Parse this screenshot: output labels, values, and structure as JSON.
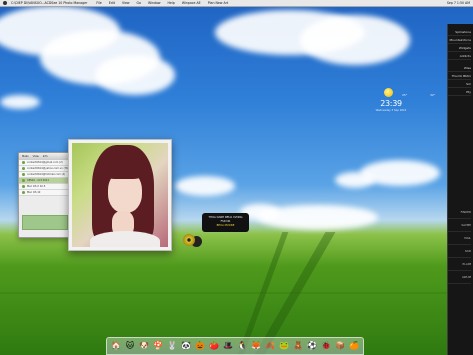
{
  "menubar": {
    "title": "C:\\DIEP DI\\VANSUO...ACDSee 10 Photo Manager",
    "items": [
      "File",
      "Edit",
      "View",
      "Go",
      "Window",
      "Help",
      "Winpace AE",
      "Plan New Art"
    ],
    "right": "Sep 7 1:50 AM"
  },
  "sidebar": {
    "top_items": [
      "Splinstone",
      "Mountainforce",
      "Widgets",
      "Addictv"
    ],
    "mid_items": [
      "Wise",
      "Thumb Bbtni",
      "Sm",
      "Pty"
    ],
    "low_items": [
      "FINDER",
      "SAVME",
      "MAIL",
      "SDD",
      "PLAIM",
      "AWUM"
    ]
  },
  "weather": {
    "temp_low": "25°",
    "temp_high": "32°",
    "time": "23:39",
    "date": "Wednesday 3 Sep 2010"
  },
  "mail_window": {
    "toolbar": [
      "Mails",
      "View",
      "Info"
    ],
    "rows": [
      "contact0614@gmail.com (2)",
      "contact0614@yahoo.com.vn (768)",
      "contact0614@hotmail.com (4)",
      "XPS10 - Oct 2011",
      "Mac OS X 10.5",
      "Mac OS 10"
    ]
  },
  "tooltip": {
    "line1": "THOA DANH BEUA XVONG",
    "line2": "FSD DR",
    "line3": "BEUA MUONE"
  },
  "dock": {
    "icons": [
      "🏠",
      "🐱",
      "🐶",
      "🍄",
      "🐰",
      "🐼",
      "🎃",
      "🍅",
      "🎩",
      "🐧",
      "🦊",
      "🍂",
      "🐸",
      "🧸",
      "⚽",
      "🐞",
      "📦",
      "🍊"
    ]
  }
}
